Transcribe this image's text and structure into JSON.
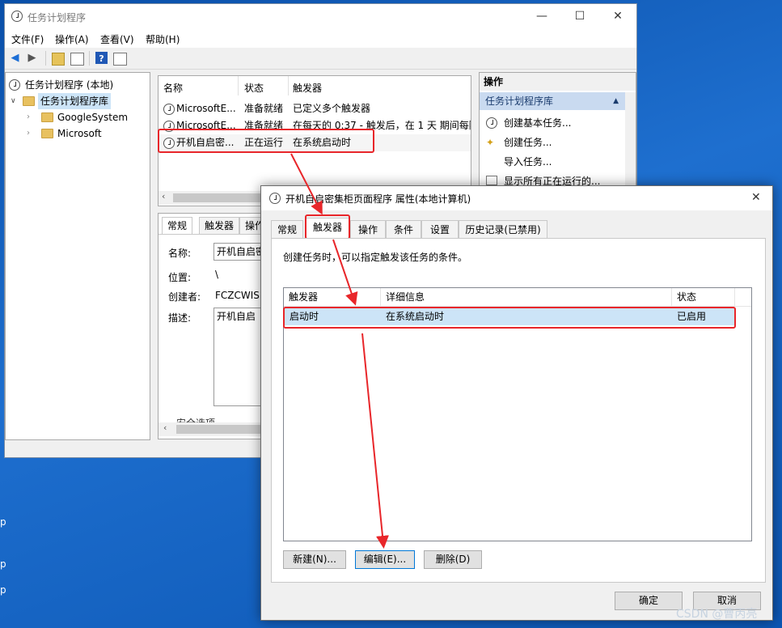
{
  "main_window": {
    "title": "任务计划程序",
    "controls": {
      "minimize": "—",
      "maximize": "☐",
      "close": "✕"
    },
    "menu": [
      "文件(F)",
      "操作(A)",
      "查看(V)",
      "帮助(H)"
    ],
    "tree": {
      "root": "任务计划程序 (本地)",
      "library": "任务计划程序库",
      "children": [
        "GoogleSystem",
        "Microsoft"
      ]
    },
    "task_list": {
      "headers": [
        "名称",
        "状态",
        "触发器"
      ],
      "rows": [
        {
          "name": "MicrosoftE...",
          "status": "准备就绪",
          "trigger": "已定义多个触发器"
        },
        {
          "name": "MicrosoftE...",
          "status": "准备就绪",
          "trigger": "在每天的 0:37 - 触发后，在 1 天 期间每隔"
        },
        {
          "name": "开机自启密...",
          "status": "正在运行",
          "trigger": "在系统启动时"
        }
      ]
    },
    "detail": {
      "tabs": [
        "常规",
        "触发器",
        "操作"
      ],
      "name_label": "名称:",
      "name_value": "开机自启密",
      "location_label": "位置:",
      "location_value": "\\",
      "author_label": "创建者:",
      "author_value": "FCZCWISD",
      "description_label": "描述:",
      "description_value": "开机自启",
      "security_label": "安全选项"
    },
    "actions": {
      "header": "操作",
      "section": "任务计划程序库",
      "items": [
        "创建基本任务...",
        "创建任务...",
        "导入任务...",
        "显示所有正在运行的..."
      ]
    }
  },
  "dialog": {
    "title": "开机自启密集柜页面程序 属性(本地计算机)",
    "close": "✕",
    "tabs": [
      "常规",
      "触发器",
      "操作",
      "条件",
      "设置",
      "历史记录(已禁用)"
    ],
    "description": "创建任务时，可以指定触发该任务的条件。",
    "table": {
      "headers": [
        "触发器",
        "详细信息",
        "状态"
      ],
      "rows": [
        {
          "trigger": "启动时",
          "details": "在系统启动时",
          "status": "已启用"
        }
      ]
    },
    "buttons": {
      "new": "新建(N)...",
      "edit": "编辑(E)...",
      "delete": "删除(D)"
    },
    "ok": "确定",
    "cancel": "取消"
  },
  "desktop_chars": [
    "p",
    "p",
    "p"
  ],
  "watermark": "CSDN @曹丙亮",
  "colors": {
    "highlight": "#e8262a",
    "selection": "#c9daf0",
    "desktop": "#1560b8"
  }
}
